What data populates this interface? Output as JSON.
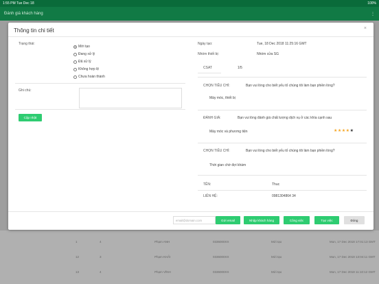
{
  "statusbar": {
    "time": "1:55 PM",
    "date": "Tue Dec 18",
    "battery": "100%"
  },
  "appbar": {
    "title": "Đánh giá khách hàng",
    "right": "⋮"
  },
  "modal": {
    "title": "Thông tin chi tiết",
    "close": "×",
    "left": {
      "status_label": "Trạng thái:",
      "status_options": [
        "Mới tạo",
        "Đang xử lý",
        "Đã xử lý",
        "Không hợp lệ",
        "Chưa hoàn thành"
      ],
      "selected_index": 0,
      "note_label": "Ghi chú:",
      "update_button": "Cập nhật"
    },
    "right": {
      "created_label": "Ngày tạo:",
      "created_value": "Tue, 18 Dec 2018 11:25:16 GMT",
      "group_label": "Nhóm thiết bị:",
      "group_value": "Nhóm cửa SG",
      "csat_label": "CSAT",
      "csat_value": "1/5",
      "q1_label": "CHỌN TIÊU CHÍ:",
      "q1_text": "Bạn vui lòng cho biết yếu tố chúng tôi làm bạn phiền lòng?",
      "q1_answer": "Máy móc, thiết bị",
      "rate_label": "ĐÁNH GIÁ:",
      "rate_text": "Bạn vui lòng đánh giá chất lượng dịch vụ ở các khía cạnh sau",
      "rate_item": "Máy móc và phương tiện",
      "rate_stars": 4,
      "rate_max": 5,
      "q2_label": "CHỌN TIÊU CHÍ:",
      "q2_text": "Bạn vui lòng cho biết yếu tố chúng tôi làm bạn phiền lòng?",
      "q2_answer": "Thời gian chờ đợi khám",
      "name_label": "TÊN:",
      "name_value": "Thuc",
      "contact_label": "LIÊN HỆ:",
      "contact_value": "0981304864 34"
    },
    "footer": {
      "email_placeholder": "email@domain.com",
      "send_email": "Gửi email",
      "customer_note": "Nhập khách hàng",
      "assign": "Công việc",
      "create_task": "Tạo việc",
      "close_button": "Đóng"
    }
  },
  "background_rows": [
    {
      "a": "1",
      "b": "4",
      "c": "Phạm ANH",
      "d": "0336000XX",
      "e": "Mới tạo",
      "f": "Mon, 17 Dec 2018 17:01:13 GMT"
    },
    {
      "a": "12",
      "b": "3",
      "c": "Phạm KHẢI",
      "d": "0336000XX",
      "e": "Mới tạo",
      "f": "Mon, 17 Dec 2018 13:04:11 GMT"
    },
    {
      "a": "13",
      "b": "4",
      "c": "Phạm VĨNH",
      "d": "0336000XX",
      "e": "Mới tạo",
      "f": "Mon, 17 Dec 2018 11:10:12 GMT"
    }
  ]
}
